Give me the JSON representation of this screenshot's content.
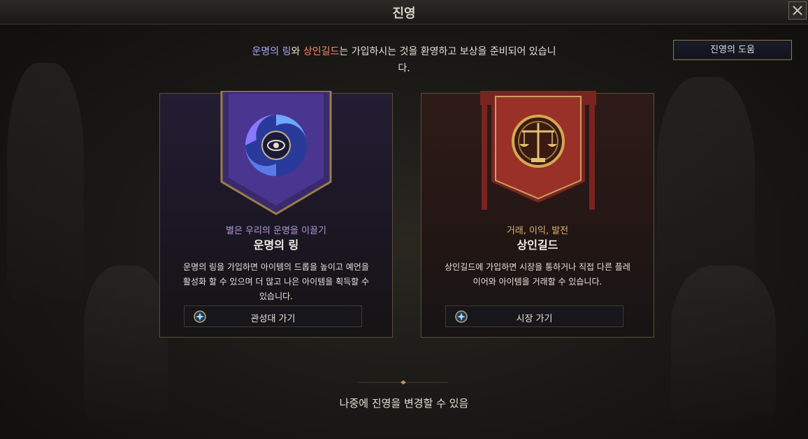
{
  "window": {
    "title": "진영"
  },
  "help_button": {
    "label": "진영의 도움"
  },
  "intro": {
    "ring_name": "운명의  링",
    "connector1": "와 ",
    "guild_name": "상인길드",
    "rest": "는 가입하시는 것을 환영하고 보상을 준비되어 있습니다."
  },
  "factions": [
    {
      "subtitle": "별은 우리의 운명을 이끌기",
      "name": "운명의 링",
      "description": "운명의 링을 가입하면 아이템의 드롭을 높이고 예언을 활성화 할 수 있으며 더 많고 나은 아이템을 획득할 수 있습니다.",
      "button_label": "관성대 가기"
    },
    {
      "subtitle": "거래, 이익, 발전",
      "name": "상인길드",
      "description": "상인길드에 가입하면 시장을 통하거나 직접 다른 플레이어와 아이템을 거래할 수 있습니다.",
      "button_label": "시장 가기"
    }
  ],
  "footer": {
    "note": "나중에 진영을 변경할 수 있음"
  },
  "colors": {
    "ring_accent": "#a8a6ff",
    "guild_accent": "#ff8a6a",
    "gold": "#b8995a"
  },
  "icons": [
    "close-icon",
    "eye-swirl-emblem-icon",
    "scales-wheel-emblem-icon",
    "plus-star-icon",
    "divider-ornament-icon"
  ]
}
